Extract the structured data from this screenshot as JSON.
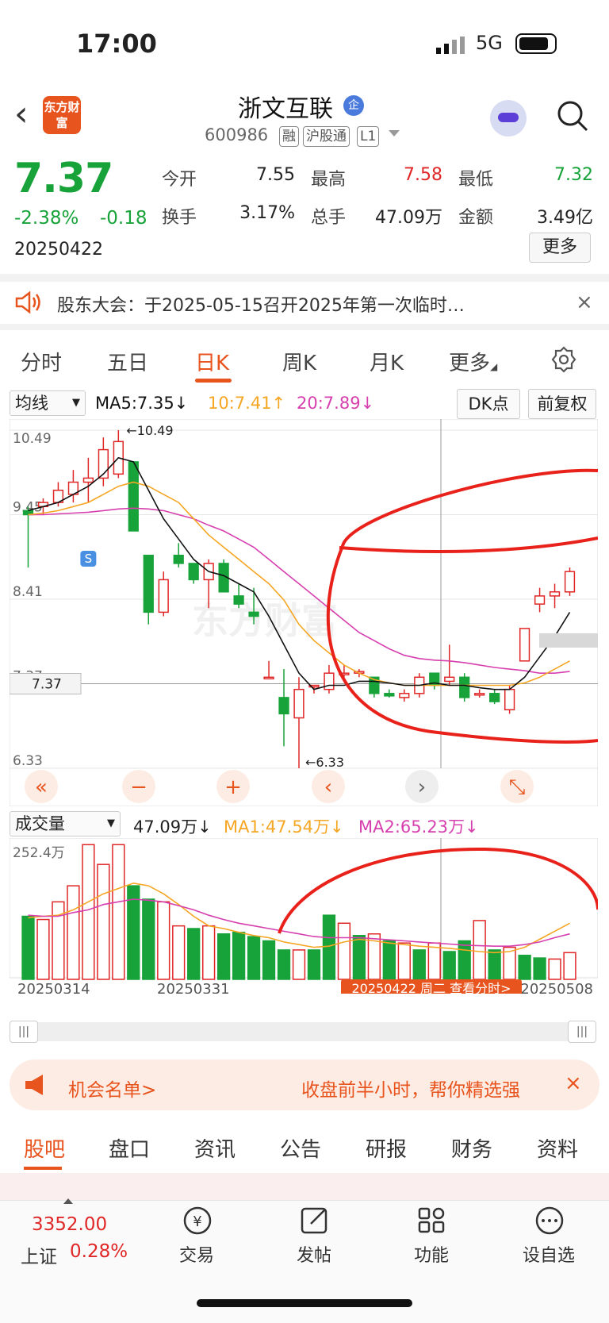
{
  "status": {
    "time": "17:00",
    "network": "5G"
  },
  "header": {
    "logo_text": "东方财富",
    "stock_name": "浙文互联",
    "ent_badge": "企",
    "stock_code": "600986",
    "tags": [
      "融",
      "沪股通",
      "L1"
    ]
  },
  "quote": {
    "price": "7.37",
    "change_pct": "-2.38%",
    "change": "-0.18",
    "date": "20250422",
    "open_label": "今开",
    "open": "7.55",
    "high_label": "最高",
    "high": "7.58",
    "low_label": "最低",
    "low": "7.32",
    "turnover_label": "换手",
    "turnover": "3.17%",
    "volume_label": "总手",
    "volume": "47.09万",
    "amount_label": "金额",
    "amount": "3.49亿",
    "more_label": "更多",
    "colors": {
      "up": "#e02727",
      "down": "#18a33a"
    }
  },
  "notice": {
    "text": "股东大会：于2025-05-15召开2025年第一次临时…",
    "close": "×"
  },
  "tabs": [
    "分时",
    "五日",
    "日K",
    "周K",
    "月K",
    "更多"
  ],
  "active_tab": "日K",
  "kchart_bar": {
    "indicator": "均线",
    "ma5": "MA5:7.35↓",
    "ma10": "10:7.41↑",
    "ma20": "20:7.89↓",
    "dk_button": "DK点",
    "adjust_button": "前复权",
    "colors": {
      "ma5": "#111111",
      "ma10": "#f5a623",
      "ma20": "#d63fae"
    }
  },
  "kchart": {
    "y_labels": [
      "10.49",
      "9.45",
      "8.41",
      "7.37",
      "6.33"
    ],
    "high_marker": "←10.49",
    "low_marker": "←6.33",
    "current_price_label": "7.37",
    "signal": "S",
    "watermark": "东方财富"
  },
  "chart_data": [
    {
      "type": "candlestick",
      "dates": [
        "20250314",
        "20250331",
        "20250422",
        "20250508"
      ],
      "ohlc": [
        [
          9.5,
          9.55,
          8.8,
          9.45
        ],
        [
          9.55,
          9.65,
          9.45,
          9.6
        ],
        [
          9.6,
          9.85,
          9.55,
          9.75
        ],
        [
          9.7,
          10.0,
          9.6,
          9.85
        ],
        [
          9.85,
          10.15,
          9.6,
          9.9
        ],
        [
          9.9,
          10.4,
          9.8,
          10.25
        ],
        [
          9.95,
          10.49,
          9.9,
          10.35
        ],
        [
          10.1,
          10.1,
          9.25,
          9.25
        ],
        [
          8.95,
          8.95,
          8.1,
          8.25
        ],
        [
          8.25,
          8.75,
          8.2,
          8.65
        ],
        [
          8.95,
          9.1,
          8.8,
          8.85
        ],
        [
          8.85,
          8.85,
          8.6,
          8.65
        ],
        [
          8.65,
          8.9,
          8.3,
          8.85
        ],
        [
          8.85,
          8.9,
          8.5,
          8.5
        ],
        [
          8.45,
          8.6,
          8.3,
          8.35
        ],
        [
          8.25,
          8.55,
          8.1,
          8.2
        ],
        [
          7.45,
          7.65,
          7.45,
          7.45
        ],
        [
          7.2,
          7.55,
          6.6,
          7.0
        ],
        [
          6.95,
          7.45,
          6.33,
          7.3
        ],
        [
          7.35,
          7.35,
          7.25,
          7.35
        ],
        [
          7.3,
          7.6,
          7.25,
          7.5
        ],
        [
          7.5,
          7.6,
          7.45,
          7.5
        ],
        [
          7.5,
          7.55,
          7.45,
          7.52
        ],
        [
          7.45,
          7.45,
          7.2,
          7.25
        ],
        [
          7.25,
          7.3,
          7.2,
          7.22
        ],
        [
          7.2,
          7.3,
          7.15,
          7.25
        ],
        [
          7.25,
          7.5,
          7.2,
          7.45
        ],
        [
          7.5,
          7.5,
          7.3,
          7.35
        ],
        [
          7.4,
          7.85,
          7.35,
          7.45
        ],
        [
          7.45,
          7.5,
          7.15,
          7.2
        ],
        [
          7.25,
          7.3,
          7.2,
          7.25
        ],
        [
          7.25,
          7.3,
          7.12,
          7.15
        ],
        [
          7.05,
          7.35,
          7.0,
          7.3
        ],
        [
          7.65,
          8.05,
          7.65,
          8.05
        ],
        [
          8.35,
          8.55,
          8.25,
          8.45
        ],
        [
          8.45,
          8.6,
          8.3,
          8.5
        ],
        [
          8.5,
          8.8,
          8.45,
          8.75
        ]
      ],
      "ylim": [
        6.33,
        10.49
      ],
      "ma5": [
        9.5,
        9.55,
        9.6,
        9.7,
        9.8,
        9.95,
        10.15,
        10.1,
        9.75,
        9.4,
        9.15,
        8.9,
        8.75,
        8.7,
        8.6,
        8.5,
        8.2,
        7.85,
        7.5,
        7.3,
        7.35,
        7.35,
        7.4,
        7.4,
        7.38,
        7.35,
        7.35,
        7.38,
        7.35,
        7.35,
        7.32,
        7.3,
        7.3,
        7.45,
        7.7,
        7.95,
        8.25
      ],
      "ma10": [
        9.45,
        9.47,
        9.5,
        9.55,
        9.6,
        9.7,
        9.8,
        9.85,
        9.8,
        9.7,
        9.6,
        9.4,
        9.2,
        9.05,
        8.9,
        8.75,
        8.6,
        8.4,
        8.1,
        7.9,
        7.75,
        7.6,
        7.5,
        7.42,
        7.38,
        7.35,
        7.35,
        7.35,
        7.35,
        7.35,
        7.35,
        7.35,
        7.35,
        7.38,
        7.45,
        7.55,
        7.65
      ],
      "ma20": [
        9.45,
        9.45,
        9.46,
        9.47,
        9.48,
        9.5,
        9.52,
        9.53,
        9.52,
        9.5,
        9.45,
        9.4,
        9.32,
        9.25,
        9.15,
        9.05,
        8.9,
        8.75,
        8.6,
        8.45,
        8.3,
        8.15,
        8.0,
        7.9,
        7.8,
        7.72,
        7.68,
        7.66,
        7.65,
        7.63,
        7.6,
        7.57,
        7.55,
        7.53,
        7.5,
        7.5,
        7.52
      ]
    },
    {
      "type": "bar",
      "title": "成交量",
      "ylim": [
        0,
        252.4
      ],
      "values": [
        118,
        112,
        145,
        175,
        252,
        215,
        252,
        175,
        150,
        145,
        100,
        95,
        100,
        85,
        88,
        80,
        72,
        55,
        55,
        55,
        120,
        105,
        82,
        85,
        72,
        68,
        55,
        68,
        52,
        72,
        110,
        55,
        60,
        45,
        40,
        38,
        50
      ],
      "up": [
        false,
        true,
        true,
        true,
        true,
        true,
        true,
        false,
        false,
        true,
        true,
        false,
        true,
        false,
        false,
        false,
        false,
        false,
        true,
        false,
        false,
        true,
        false,
        true,
        false,
        true,
        false,
        true,
        false,
        false,
        true,
        false,
        true,
        false,
        false,
        true,
        true
      ],
      "ma1": [
        115,
        118,
        120,
        130,
        145,
        160,
        170,
        180,
        175,
        160,
        140,
        118,
        100,
        95,
        88,
        82,
        78,
        70,
        65,
        60,
        62,
        70,
        75,
        72,
        68,
        65,
        62,
        60,
        58,
        55,
        52,
        50,
        52,
        60,
        75,
        90,
        105
      ],
      "ma2": [
        120,
        118,
        118,
        125,
        130,
        140,
        145,
        150,
        148,
        145,
        138,
        130,
        120,
        112,
        105,
        100,
        95,
        90,
        85,
        80,
        78,
        78,
        78,
        76,
        74,
        72,
        70,
        68,
        66,
        64,
        63,
        62,
        62,
        65,
        70,
        78,
        85
      ]
    }
  ],
  "vol_bar": {
    "indicator": "成交量",
    "value": "47.09万↓",
    "ma1": "MA1:47.54万↓",
    "ma2": "MA2:65.23万↓",
    "y_max_label": "252.4万",
    "date_labels": [
      "20250314",
      "20250331",
      "20250508"
    ],
    "tooltip": "20250422 周二 查看分时>"
  },
  "banner": {
    "left": "机会名单>",
    "right": "收盘前半小时，帮你精选强",
    "close": "×"
  },
  "bottom_tabs": [
    "股吧",
    "盘口",
    "资讯",
    "公告",
    "研报",
    "财务",
    "资料"
  ],
  "bottom_nav": {
    "index_value": "3352.00",
    "index_name": "上证",
    "index_change": "0.28%",
    "items": [
      "交易",
      "发帖",
      "功能",
      "设自选"
    ]
  }
}
